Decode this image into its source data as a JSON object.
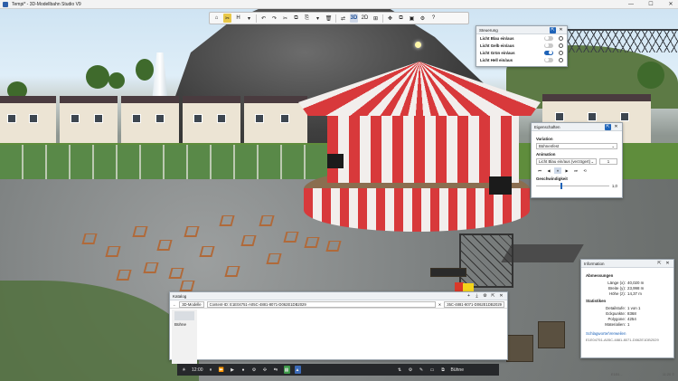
{
  "window": {
    "title": "Tempi* - 3D-Modellbahn Studio V9",
    "min": "—",
    "max": "☐",
    "close": "✕"
  },
  "toolbar": {
    "buttons": [
      "⌂",
      "✂",
      "H",
      "▾",
      "↶",
      "↷",
      "✂",
      "⧉",
      "⎘",
      "▾",
      "🗑",
      "⇄",
      "3D",
      "2D",
      "⊞",
      "✥",
      "⧉",
      "▣",
      "⚙",
      "?"
    ],
    "selected_index": 1
  },
  "steuerung": {
    "title": "Steuerung",
    "items": [
      {
        "label": "Licht Blau ein/aus",
        "on": false
      },
      {
        "label": "Licht Gelb ein/aus",
        "on": false
      },
      {
        "label": "Licht Grün ein/aus",
        "on": true
      },
      {
        "label": "Licht Hell ein/aus",
        "on": false
      }
    ]
  },
  "eigenschaften": {
    "title": "Eigenschaften",
    "variation_label": "Variation",
    "variation_value": "Bühnenfest",
    "animation_label": "Animation",
    "animation_value": "Licht Blau ein/aus (verzögert)",
    "animation_count": "1",
    "anim_buttons": [
      "⏮",
      "◀",
      "⏸",
      "▶",
      "⏭",
      "⟲"
    ],
    "speed_label": "Geschwindigkeit",
    "speed_value": "1,0",
    "speed_fraction": 0.33
  },
  "information": {
    "title": "Information",
    "dim_title": "Abmessungen",
    "dims": [
      {
        "k": "Länge (x):",
        "v": "40,020 m"
      },
      {
        "k": "Breite (y):",
        "v": "23,998 m"
      },
      {
        "k": "Höhe (z):",
        "v": "14,37 m"
      }
    ],
    "stats_title": "Statistiken",
    "stats": [
      {
        "k": "Detailstufe:",
        "v": "1 von 1"
      },
      {
        "k": "Eckpunkte:",
        "v": "8368"
      },
      {
        "k": "Polygone:",
        "v": "4254"
      },
      {
        "k": "Materialien:",
        "v": "1"
      }
    ],
    "link": "Schlagworte/Verweilen",
    "id_text": "E1E04751-A05C-4881-8071-D062E1DB2029"
  },
  "katalog": {
    "title": "Katalog",
    "source": "3D-Modelle",
    "search_text": "Content-ID: E1E04751-A05C-4881-8071-D062E1DB2029",
    "result_text": "35C-4881-8071-D062E1DB2029",
    "items": [
      "Bühne"
    ]
  },
  "bottombar": {
    "time": "12:00",
    "label": "Bühne"
  },
  "status": {
    "left": "E1E0...",
    "right": "11:20 ©"
  }
}
